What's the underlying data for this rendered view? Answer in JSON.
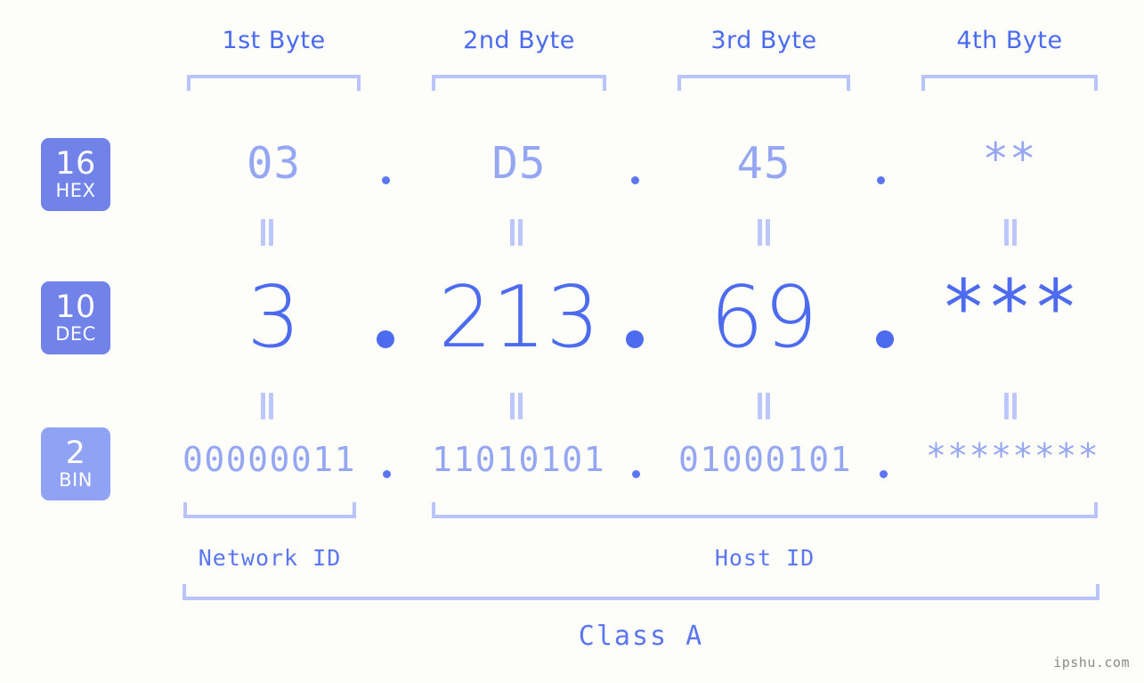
{
  "background_color": "#fdfefa",
  "accent_color": "#4d6bee",
  "muted_accent_color": "#95a7f2",
  "bracket_color": "#b9c4fa",
  "badge_color": "#7183e8",
  "badge_color_light": "#8fa2f3",
  "headers": {
    "byte1": "1st Byte",
    "byte2": "2nd Byte",
    "byte3": "3rd Byte",
    "byte4": "4th Byte"
  },
  "badges": {
    "hex": {
      "radix": "16",
      "name": "HEX"
    },
    "dec": {
      "radix": "10",
      "name": "DEC"
    },
    "bin": {
      "radix": "2",
      "name": "BIN"
    }
  },
  "rows": {
    "hex": {
      "b1": "03",
      "b2": "D5",
      "b3": "45",
      "b4": "**"
    },
    "dec": {
      "b1": "3",
      "b2": "213",
      "b3": "69",
      "b4": "***"
    },
    "bin": {
      "b1": "00000011",
      "b2": "11010101",
      "b3": "01000101",
      "b4": "********"
    }
  },
  "separator": ".",
  "equivalence_mark": "||",
  "sections": {
    "network_id": "Network ID",
    "host_id": "Host ID",
    "class": "Class A"
  },
  "watermark": "ipshu.com"
}
